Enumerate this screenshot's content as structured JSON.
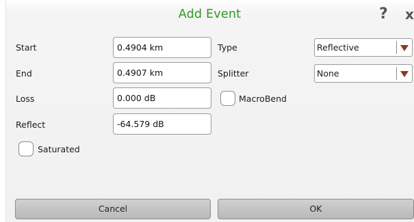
{
  "dialog": {
    "title": "Add Event",
    "help_glyph": "?",
    "close_glyph": "x"
  },
  "fields": {
    "start": {
      "label": "Start",
      "value": "0.4904 km"
    },
    "end": {
      "label": "End",
      "value": "0.4907 km"
    },
    "loss": {
      "label": "Loss",
      "value": "0.000 dB"
    },
    "reflect": {
      "label": "Reflect",
      "value": "-64.579 dB"
    }
  },
  "selects": {
    "type": {
      "label": "Type",
      "value": "Reflective"
    },
    "splitter": {
      "label": "Splitter",
      "value": "None"
    }
  },
  "checkboxes": {
    "macrobend": {
      "label": "MacroBend",
      "checked": false
    },
    "saturated": {
      "label": "Saturated",
      "checked": false
    }
  },
  "buttons": {
    "cancel": "Cancel",
    "ok": "OK"
  },
  "icons": {
    "help": "help-icon",
    "close": "close-icon",
    "dropdown": "chevron-down-icon"
  },
  "colors": {
    "title": "#2f9a23",
    "dropdown_arrow": "#8b3a22",
    "button_face": "#c4c4c4"
  }
}
